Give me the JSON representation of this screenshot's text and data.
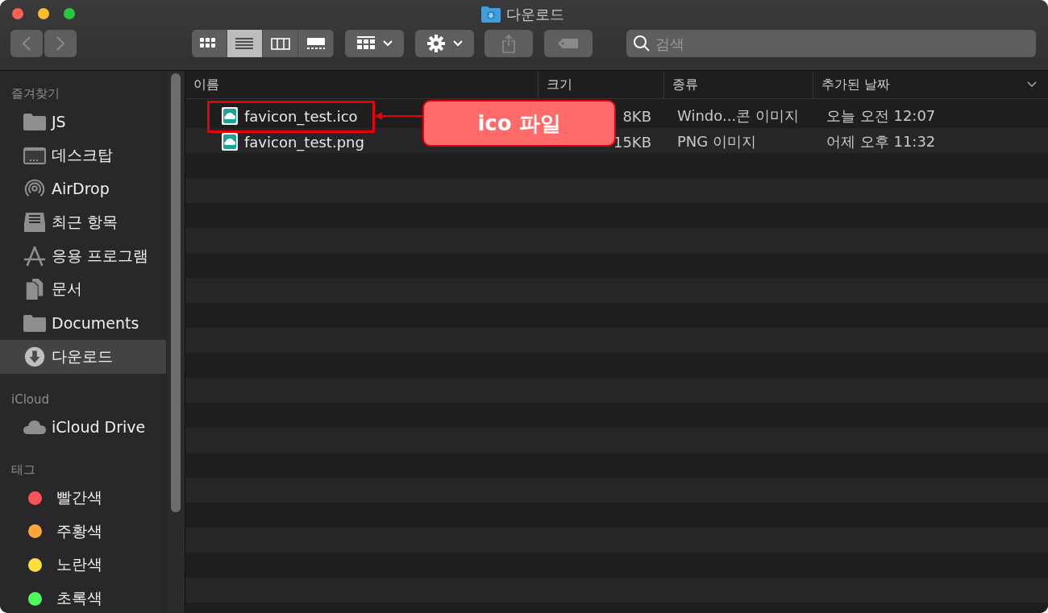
{
  "window": {
    "title": "다운로드"
  },
  "toolbar": {
    "view_modes": [
      {
        "kind": "icons",
        "selected": false
      },
      {
        "kind": "list",
        "selected": true
      },
      {
        "kind": "columns",
        "selected": false
      },
      {
        "kind": "gallery",
        "selected": false
      }
    ],
    "search": {
      "placeholder": "검색"
    }
  },
  "sidebar": {
    "sections": [
      {
        "title": "즐겨찾기",
        "items": [
          {
            "kind": "folder",
            "label": "JS",
            "selected": false
          },
          {
            "kind": "desktop",
            "label": "데스크탑",
            "selected": false
          },
          {
            "kind": "airdrop",
            "label": "AirDrop",
            "selected": false
          },
          {
            "kind": "recents",
            "label": "최근 항목",
            "selected": false
          },
          {
            "kind": "apps",
            "label": "응용 프로그램",
            "selected": false
          },
          {
            "kind": "documents",
            "label": "문서",
            "selected": false
          },
          {
            "kind": "folder",
            "label": "Documents",
            "selected": false
          },
          {
            "kind": "downloads",
            "label": "다운로드",
            "selected": true
          }
        ]
      },
      {
        "title": "iCloud",
        "items": [
          {
            "kind": "cloud",
            "label": "iCloud Drive",
            "selected": false
          }
        ]
      },
      {
        "title": "태그",
        "items": [
          {
            "kind": "tag",
            "label": "빨간색",
            "color": "#ff5257",
            "selected": false
          },
          {
            "kind": "tag",
            "label": "주황색",
            "color": "#ffa53a",
            "selected": false
          },
          {
            "kind": "tag",
            "label": "노란색",
            "color": "#ffdf3d",
            "selected": false
          },
          {
            "kind": "tag",
            "label": "초록색",
            "color": "#4dfb5b",
            "selected": false
          }
        ]
      }
    ]
  },
  "table": {
    "columns": [
      "이름",
      "크기",
      "종류",
      "추가된 날짜"
    ],
    "rows": [
      {
        "name": "favicon_test.ico",
        "size": "8KB",
        "type": "Windo...콘 이미지",
        "date": "오늘 오전 12:07"
      },
      {
        "name": "favicon_test.png",
        "size": "15KB",
        "type": "PNG 이미지",
        "date": "어제 오후 11:32"
      }
    ]
  },
  "callout": {
    "label": "ico 파일"
  }
}
